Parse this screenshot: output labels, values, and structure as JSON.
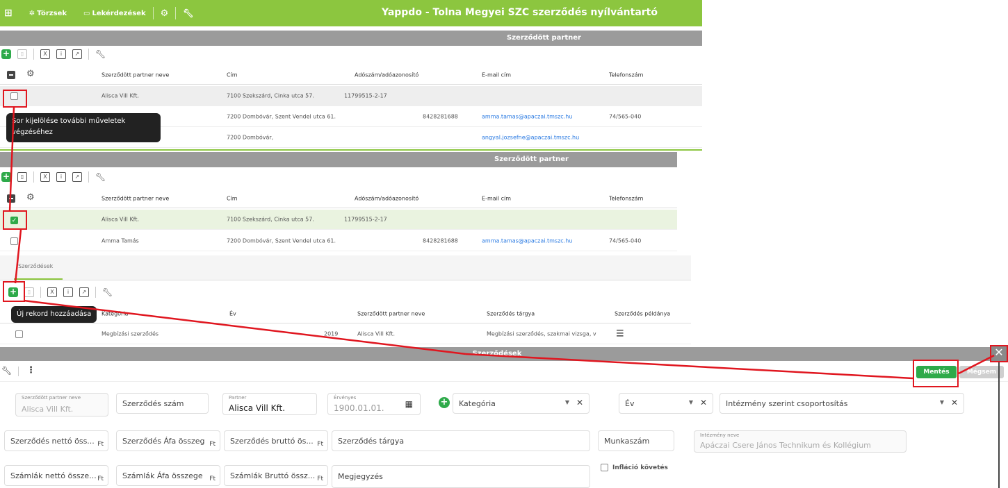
{
  "topbar": {
    "nav_torzsek": "Törzsek",
    "nav_lekerdezesek": "Lekérdezések",
    "app_title": "Yappdo - Tolna Megyei SZC szerződés nyílvántartó"
  },
  "panel1": {
    "header": "Szerződött partner",
    "columns": [
      "Szerződött partner neve",
      "Cím",
      "Adószám/adóazonosító",
      "E-mail cím",
      "Telefonszám"
    ],
    "rows": [
      {
        "name": "Alisca Vill Kft.",
        "address": "7100 Szekszárd, Cinka utca 57.",
        "tax": "11799515-2-17",
        "email": "",
        "phone": ""
      },
      {
        "name": "",
        "address": "7200 Dombóvár, Szent Vendel utca 61.",
        "tax": "8428281688",
        "email": "amma.tamas@apaczai.tmszc.hu",
        "phone": "74/565-040"
      },
      {
        "name": "",
        "address": "7200 Dombóvár,",
        "tax": "",
        "email": "angyal.jozsefne@apaczai.tmszc.hu",
        "phone": ""
      }
    ],
    "tooltip": "Sor kijelölése további műveletek végzéséhez"
  },
  "panel2": {
    "header": "Szerződött partner",
    "columns": [
      "Szerződött partner neve",
      "Cím",
      "Adószám/adóazonosító",
      "E-mail cím",
      "Telefonszám"
    ],
    "rows": [
      {
        "name": "Alisca Vill Kft.",
        "address": "7100 Szekszárd, Cinka utca 57.",
        "tax": "11799515-2-17",
        "email": "",
        "phone": ""
      },
      {
        "name": "Amma Tamás",
        "address": "7200 Dombóvár, Szent Vendel utca 61.",
        "tax": "8428281688",
        "email": "amma.tamas@apaczai.tmszc.hu",
        "phone": "74/565-040"
      }
    ],
    "tab_label": "Szerződések",
    "tooltip": "Új rekord hozzáadása",
    "contract_columns": [
      "Kategória",
      "Év",
      "Szerződött partner neve",
      "Szerződés tárgya",
      "Szerződés példánya"
    ],
    "contract_rows": [
      {
        "category": "Megbízási szerződés",
        "year": "2019",
        "partner": "Alisca Vill Kft.",
        "subject": "Megbízási szerződés, szakmai vizsga, v"
      }
    ]
  },
  "form": {
    "header": "Szerződések",
    "save_label": "Mentés",
    "cancel_label": "Mégsem",
    "partner_name_label": "Szerződött partner neve",
    "partner_name_value": "Alisca Vill Kft.",
    "contract_number_placeholder": "Szerződés szám",
    "partner_label": "Partner",
    "partner_value": "Alisca Vill Kft.",
    "valid_label": "Érvényes",
    "valid_value": "1900.01.01.",
    "category_placeholder": "Kategória",
    "year_placeholder": "Év",
    "grouping_placeholder": "Intézmény szerint csoportosítás",
    "net_amount": "Szerződés nettó öss...",
    "vat_amount": "Szerződés Áfa összeg",
    "gross_amount": "Szerződés bruttó ös...",
    "currency": "Ft",
    "subject_placeholder": "Szerződés tárgya",
    "work_number_placeholder": "Munkaszám",
    "institution_label": "Intézmény neve",
    "institution_value": "Apáczai Csere János Technikum és Kollégium",
    "invoice_net": "Számlák nettó össze...",
    "invoice_vat": "Számlák Áfa összege",
    "invoice_gross": "Számlák Bruttó össz...",
    "note_placeholder": "Megjegyzés",
    "inflation_label": "Infláció követés"
  },
  "colors": {
    "brand_green": "#8cc63f",
    "header_grey": "#9b9b9b",
    "highlight_red": "#e0161f"
  }
}
